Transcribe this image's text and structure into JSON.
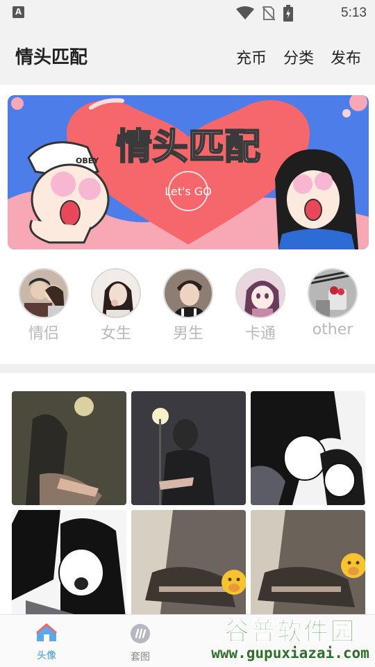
{
  "status_bar": {
    "app_icon_letter": "A",
    "time": "5:13"
  },
  "header": {
    "title": "情头匹配",
    "actions": [
      "充币",
      "分类",
      "发布"
    ]
  },
  "banner": {
    "headline": "情头匹配",
    "cap_text": "OBEY",
    "badge_text": "Let's GO"
  },
  "categories": [
    {
      "label": "情侣",
      "icon": "couple-avatar"
    },
    {
      "label": "女生",
      "icon": "girl-avatar"
    },
    {
      "label": "男生",
      "icon": "boy-avatar"
    },
    {
      "label": "卡通",
      "icon": "cartoon-avatar"
    },
    {
      "label": "other",
      "icon": "other-avatar"
    }
  ],
  "grid": {
    "items": [
      {
        "name": "photo-night-hand"
      },
      {
        "name": "photo-night-boy"
      },
      {
        "name": "photo-anime-couple-a"
      },
      {
        "name": "photo-anime-couple-b"
      },
      {
        "name": "photo-blur-couple-a"
      },
      {
        "name": "photo-blur-couple-b"
      }
    ]
  },
  "bottom_nav": {
    "items": [
      {
        "label": "头像",
        "active": true
      },
      {
        "label": "套图",
        "active": false
      }
    ]
  },
  "watermark": {
    "main": "谷普软件园",
    "url": "www.gupuxiazai.com"
  },
  "colors": {
    "accent": "#3a95e0",
    "banner_bg": "#4c7de8",
    "heart": "#f5676b",
    "watermark": "#3fa23a"
  }
}
